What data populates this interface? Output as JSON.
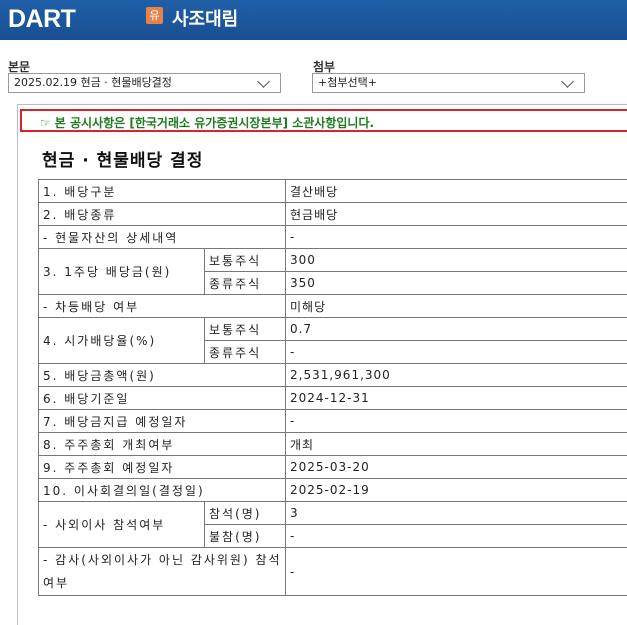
{
  "header": {
    "logo": "DART",
    "badge": "유",
    "company": "사조대림"
  },
  "selectors": {
    "main_label": "본문",
    "main_value": "2025.02.19  현금 · 현물배당결정",
    "attach_label": "첨부",
    "attach_value": "+첨부선택+"
  },
  "notice": {
    "icon": "☞",
    "text": "본 공시사항은 [한국거래소 유가증권시장본부] 소관사항입니다."
  },
  "doc": {
    "title": "현금 · 현물배당 결정",
    "rows": {
      "r1_label": "1. 배당구분",
      "r1_value": "결산배당",
      "r2_label": "2. 배당종류",
      "r2_value": "현금배당",
      "r3_label": "- 현물자산의 상세내역",
      "r3_value": "-",
      "r4_label": "3. 1주당 배당금(원)",
      "r4_sub1": "보통주식",
      "r4_val1": "300",
      "r4_sub2": "종류주식",
      "r4_val2": "350",
      "r5_label": "- 차등배당 여부",
      "r5_value": "미해당",
      "r6_label": "4. 시가배당율(%)",
      "r6_sub1": "보통주식",
      "r6_val1": "0.7",
      "r6_sub2": "종류주식",
      "r6_val2": "-",
      "r7_label": "5. 배당금총액(원)",
      "r7_value": "2,531,961,300",
      "r8_label": "6. 배당기준일",
      "r8_value": "2024-12-31",
      "r9_label": "7. 배당금지급 예정일자",
      "r9_value": "-",
      "r10_label": "8. 주주총회 개최여부",
      "r10_value": "개최",
      "r11_label": "9. 주주총회 예정일자",
      "r11_value": "2025-03-20",
      "r12_label": "10. 이사회결의일(결정일)",
      "r12_value": "2025-02-19",
      "r13_label": "- 사외이사 참석여부",
      "r13_sub1": "참석(명)",
      "r13_val1": "3",
      "r13_sub2": "불참(명)",
      "r13_val2": "-",
      "r14_label": "- 감사(사외이사가 아닌 감사위원) 참석여부",
      "r14_value": "-"
    }
  }
}
